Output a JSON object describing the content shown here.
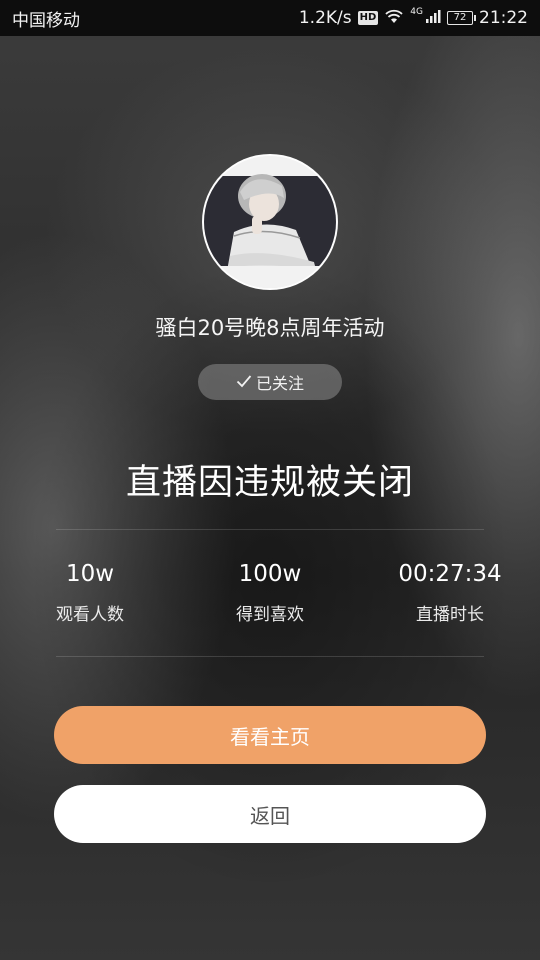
{
  "status_bar": {
    "carrier": "中国移动",
    "net_speed": "1.2K/s",
    "hd_badge": "HD",
    "wifi_icon": "wifi-icon",
    "signal_label": "4G",
    "signal_icon": "signal-bars-icon",
    "battery_level": "72",
    "time": "21:22"
  },
  "anchor": {
    "avatar_icon": "avatar-illustration",
    "name": "骚白20号晚8点周年活动",
    "follow_label": "已关注",
    "follow_icon": "checkmark-icon"
  },
  "headline": "直播因违规被关闭",
  "stats": [
    {
      "value": "10w",
      "label": "观看人数"
    },
    {
      "value": "100w",
      "label": "得到喜欢"
    },
    {
      "value": "00:27:34",
      "label": "直播时长"
    }
  ],
  "actions": {
    "view_home_label": "看看主页",
    "back_label": "返回"
  },
  "colors": {
    "accent": "#f0a268",
    "status_bar_bg": "#0d0d0d",
    "secondary_button_bg": "#ffffff"
  }
}
